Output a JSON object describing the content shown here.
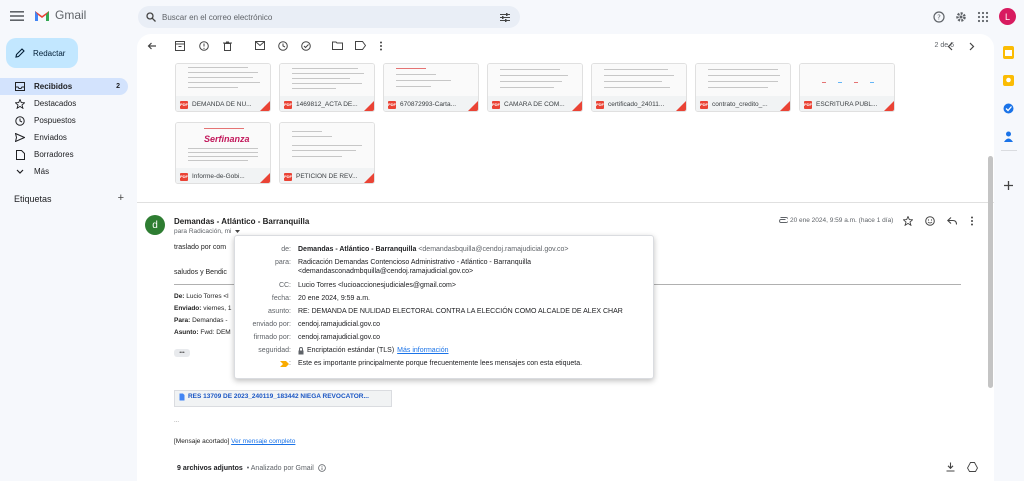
{
  "app": {
    "name": "Gmail"
  },
  "search": {
    "placeholder": "Buscar en el correo electrónico"
  },
  "user": {
    "initial": "L",
    "color": "#d81b60"
  },
  "compose": {
    "label": "Redactar"
  },
  "sidebar": {
    "items": [
      {
        "label": "Recibidos",
        "count": "2",
        "icon": "inbox-icon",
        "active": true
      },
      {
        "label": "Destacados",
        "icon": "star-icon"
      },
      {
        "label": "Pospuestos",
        "icon": "clock-icon"
      },
      {
        "label": "Enviados",
        "icon": "send-icon"
      },
      {
        "label": "Borradores",
        "icon": "draft-icon"
      },
      {
        "label": "Más",
        "icon": "chevron-down-icon"
      }
    ],
    "labels_title": "Etiquetas",
    "add_label": "+"
  },
  "toolbar": {
    "pager": "2 de 6"
  },
  "attachments_top": [
    {
      "name": "DEMANDA DE NU..."
    },
    {
      "name": "1469812_ACTA DE..."
    },
    {
      "name": "670872993-Carta..."
    },
    {
      "name": "CAMARA DE COM..."
    },
    {
      "name": "certificado_24011..."
    },
    {
      "name": "contrato_credito_..."
    },
    {
      "name": "ESCRITURA PÚBL..."
    },
    {
      "name": "Informe-de-Gobi..."
    },
    {
      "name": "PETICION DE REV..."
    }
  ],
  "thumb_texts": {
    "serfinanza": "Serfinanza"
  },
  "email": {
    "avatar_initial": "d",
    "sender": "Demandas - Atlántico - Barranquilla",
    "to_short": "para Radicación, mi",
    "date": "20 ene 2024, 9:59 a.m. (hace 1 día)",
    "body_line1": "traslado por com",
    "body_line2": "saludos y Bendic",
    "fwd_de_label": "De:",
    "fwd_de": "Lucio Torres <l",
    "fwd_enviado_label": "Enviado:",
    "fwd_enviado": "viernes, 1",
    "fwd_para_label": "Para:",
    "fwd_para": "Demandas - ",
    "fwd_asunto_label": "Asunto:",
    "fwd_asunto": "Fwd: DEM",
    "ellipsis": "•••",
    "doc_link": "RES 13709 DE 2023_240119_183442 NIEGA REVOCATOR...",
    "trunc_prefix": "[Mensaje acortado]",
    "trunc_link": "Ver mensaje completo",
    "attachments_count": "9 archivos adjuntos",
    "scanned": "• Analizado por Gmail"
  },
  "popup": {
    "de_k": "de:",
    "de_name": "Demandas - Atlántico - Barranquilla",
    "de_email": "<demandasbquilla@cendoj.ramajudicial.gov.co>",
    "para_k": "para:",
    "para_v1": "Radicación Demandas Contencioso Administrativo - Atlántico - Barranquilla",
    "para_v2": "<demandasconadmbquilla@cendoj.ramajudicial.gov.co>",
    "cc_k": "CC:",
    "cc_v": "Lucio Torres <lucioaccionesjudiciales@gmail.com>",
    "fecha_k": "fecha:",
    "fecha_v": "20 ene 2024, 9:59 a.m.",
    "asunto_k": "asunto:",
    "asunto_v": "RE: DEMANDA DE NULIDAD ELECTORAL CONTRA LA ELECCIÓN COMO ALCALDE DE ALEX CHAR",
    "enviado_k": "enviado por:",
    "enviado_v": "cendoj.ramajudicial.gov.co",
    "firmado_k": "firmado por:",
    "firmado_v": "cendoj.ramajudicial.gov.co",
    "seguridad_k": "seguridad:",
    "seguridad_v": "Encriptación estándar (TLS)",
    "seguridad_link": "Más información",
    "importance_v": "Este es importante principalmente porque frecuentemente lees mensajes con esta etiqueta."
  }
}
